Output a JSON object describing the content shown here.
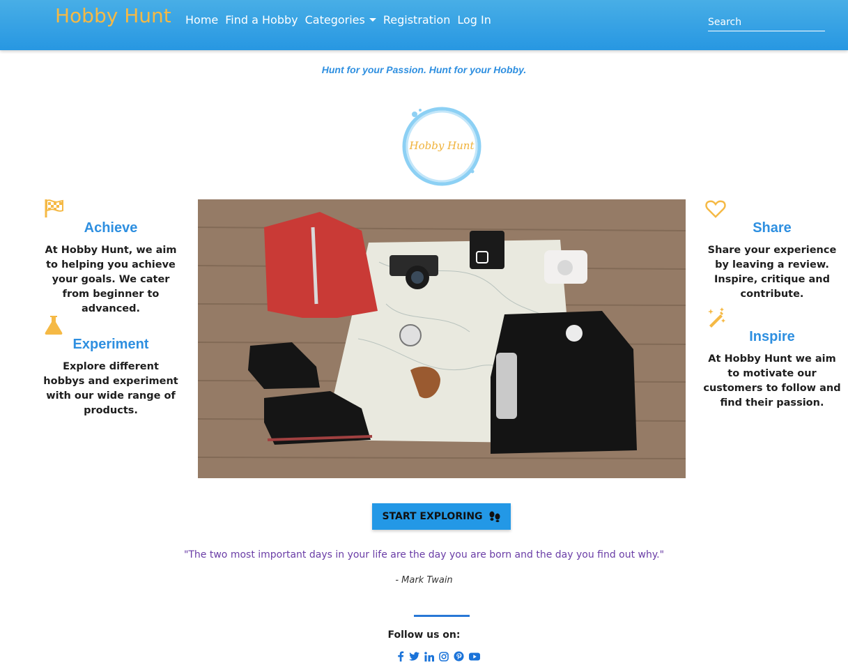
{
  "navbar": {
    "brand": "Hobby Hunt",
    "links": [
      "Home",
      "Find a Hobby",
      "Categories",
      "Registration",
      "Log In"
    ],
    "search_placeholder": "Search"
  },
  "tagline": "Hunt for your Passion. Hunt for your Hobby.",
  "logo_text": "Hobby Hunt",
  "features_left": [
    {
      "icon": "checkered-flag-icon",
      "title": "Achieve",
      "text": "At Hobby Hunt, we aim to helping you achieve your goals. We cater from beginner to advanced."
    },
    {
      "icon": "flask-icon",
      "title": "Experiment",
      "text": "Explore different hobbys and experiment with our wide range of products."
    }
  ],
  "features_right": [
    {
      "icon": "heart-icon",
      "title": "Share",
      "text": "Share your experience by leaving a review. Inspire, critique and contribute."
    },
    {
      "icon": "magic-wand-icon",
      "title": "Inspire",
      "text": "At Hobby Hunt we aim to motivate our customers to follow and find their passion."
    }
  ],
  "cta": {
    "label": "START EXPLORING",
    "icon": "footprints-icon"
  },
  "quote": "\"The two most important days in your life are the day you are born and the day you find out why.\"",
  "quote_author": "- Mark Twain",
  "footer": {
    "follow_label": "Follow us on:",
    "social_icons": [
      "facebook-icon",
      "twitter-icon",
      "linkedin-icon",
      "instagram-icon",
      "pinterest-icon",
      "youtube-icon"
    ]
  },
  "colors": {
    "nav": "#2797e2",
    "brand": "#f5b945",
    "accent": "#2e8fe0",
    "icon": "#f5b945",
    "quote": "#6a3da6"
  }
}
